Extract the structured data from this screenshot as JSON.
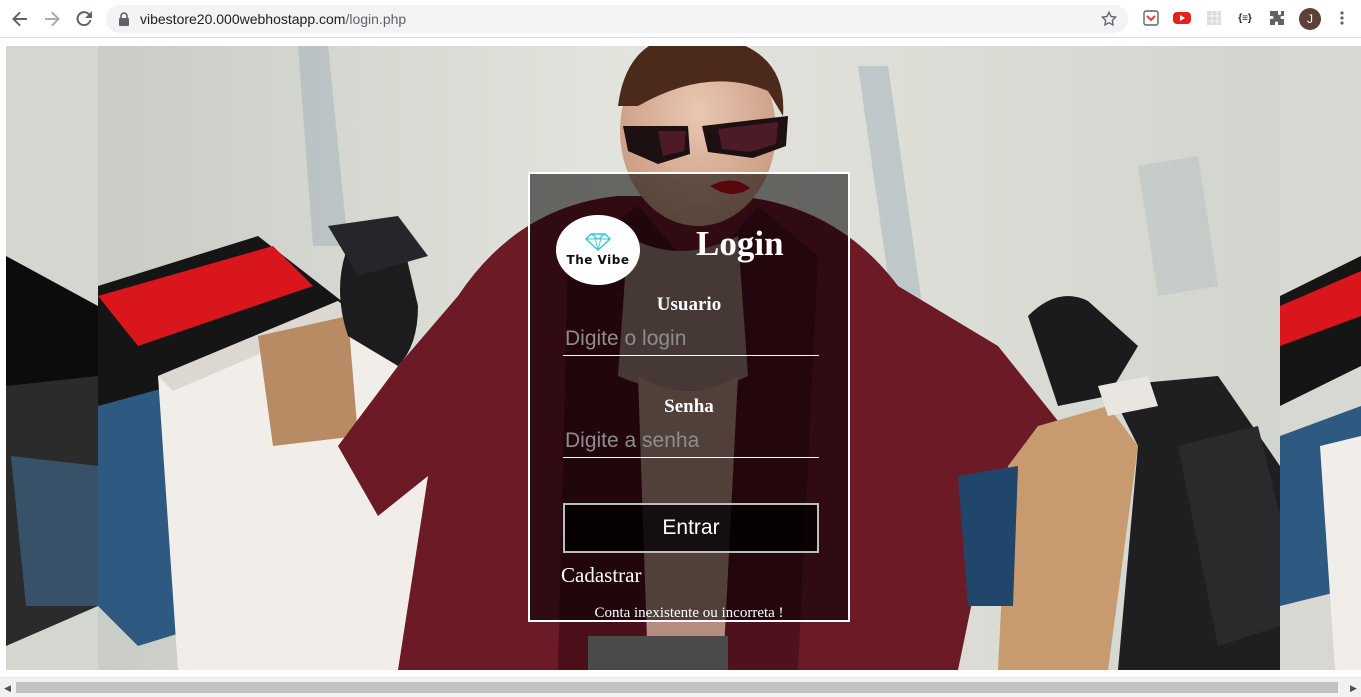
{
  "browser": {
    "url_host": "vibestore20.000webhostapp.com",
    "url_path": "/login.php",
    "profile_initial": "J",
    "extensions": [
      "pocket-icon",
      "youtube-icon",
      "grid-icon",
      "json-formatter-icon",
      "puzzle-extensions-icon"
    ],
    "extension_json_label": "{≡}"
  },
  "login": {
    "logo_text": "The Vibe",
    "title": "Login",
    "user_label": "Usuario",
    "user_placeholder": "Digite o login",
    "password_label": "Senha",
    "password_placeholder": "Digite a senha",
    "submit_label": "Entrar",
    "register_link": "Cadastrar",
    "error_message": "Conta inexistente ou incorreta !"
  },
  "colors": {
    "panel_border": "#ffffff",
    "text": "#ffffff",
    "coat": "#6b1a26",
    "bag_red": "#e01a22"
  }
}
